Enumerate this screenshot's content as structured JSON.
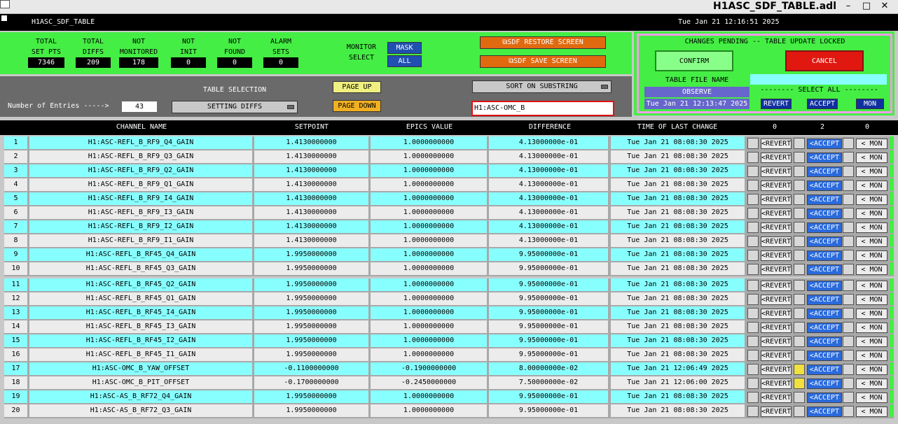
{
  "window": {
    "title": "H1ASC_SDF_TABLE.adl",
    "minimize": "–",
    "maximize": "□",
    "close": "✕"
  },
  "topbar": {
    "name": "H1ASC_SDF_TABLE",
    "datetime": "Tue Jan 21 12:16:51 2025"
  },
  "stats": [
    {
      "l1": "TOTAL",
      "l2": "SET PTS",
      "value": "7346"
    },
    {
      "l1": "TOTAL",
      "l2": "DIFFS",
      "value": "209"
    },
    {
      "l1": "NOT",
      "l2": "MONITORED",
      "value": "178"
    },
    {
      "l1": "NOT",
      "l2": "INIT",
      "value": "0"
    },
    {
      "l1": "NOT",
      "l2": "FOUND",
      "value": "0"
    },
    {
      "l1": "ALARM",
      "l2": "SETS",
      "value": "0"
    }
  ],
  "monitor": {
    "l1": "MONITOR",
    "l2": "SELECT",
    "mask": "MASK",
    "all": "ALL"
  },
  "screens": {
    "restore": "SDF RESTORE SCREEN",
    "save": "SDF SAVE SCREEN"
  },
  "changes": {
    "title": "CHANGES PENDING -- TABLE UPDATE LOCKED",
    "confirm": "CONFIRM",
    "cancel": "CANCEL",
    "file_label": "TABLE FILE NAME",
    "file_name": "OBSERVE",
    "file_date": "Tue Jan 21 12:13:47 2025",
    "select_all": "-------- SELECT ALL --------",
    "revert": "REVERT",
    "accept": "ACCEPT",
    "mon": "MON"
  },
  "controls": {
    "entries_label": "Number of Entries ----->",
    "entries": "43",
    "table_sel_label": "TABLE SELECTION",
    "table_sel": "SETTING DIFFS",
    "page_up": "PAGE UP",
    "page_down": "PAGE DOWN",
    "sort": "SORT ON SUBSTRING",
    "substring": "H1:ASC-OMC_B"
  },
  "header": {
    "channel": "CHANNEL NAME",
    "setpoint": "SETPOINT",
    "epics": "EPICS VALUE",
    "diff": "DIFFERENCE",
    "time": "TIME OF LAST CHANGE",
    "count_revert": "0",
    "count_accept": "2",
    "count_mon": "0"
  },
  "row_buttons": {
    "revert": "<REVERT",
    "accept": "<ACCEPT",
    "mon": "< MON"
  },
  "rows": [
    {
      "n": "1",
      "name": "H1:ASC-REFL_B_RF9_Q4_GAIN",
      "sp": "1.4130000000",
      "ev": "1.0000000000",
      "diff": "4.13000000e-01",
      "time": "Tue Jan 21 08:08:30 2025",
      "flag": false
    },
    {
      "n": "2",
      "name": "H1:ASC-REFL_B_RF9_Q3_GAIN",
      "sp": "1.4130000000",
      "ev": "1.0000000000",
      "diff": "4.13000000e-01",
      "time": "Tue Jan 21 08:08:30 2025",
      "flag": false
    },
    {
      "n": "3",
      "name": "H1:ASC-REFL_B_RF9_Q2_GAIN",
      "sp": "1.4130000000",
      "ev": "1.0000000000",
      "diff": "4.13000000e-01",
      "time": "Tue Jan 21 08:08:30 2025",
      "flag": false
    },
    {
      "n": "4",
      "name": "H1:ASC-REFL_B_RF9_Q1_GAIN",
      "sp": "1.4130000000",
      "ev": "1.0000000000",
      "diff": "4.13000000e-01",
      "time": "Tue Jan 21 08:08:30 2025",
      "flag": false
    },
    {
      "n": "5",
      "name": "H1:ASC-REFL_B_RF9_I4_GAIN",
      "sp": "1.4130000000",
      "ev": "1.0000000000",
      "diff": "4.13000000e-01",
      "time": "Tue Jan 21 08:08:30 2025",
      "flag": false
    },
    {
      "n": "6",
      "name": "H1:ASC-REFL_B_RF9_I3_GAIN",
      "sp": "1.4130000000",
      "ev": "1.0000000000",
      "diff": "4.13000000e-01",
      "time": "Tue Jan 21 08:08:30 2025",
      "flag": false
    },
    {
      "n": "7",
      "name": "H1:ASC-REFL_B_RF9_I2_GAIN",
      "sp": "1.4130000000",
      "ev": "1.0000000000",
      "diff": "4.13000000e-01",
      "time": "Tue Jan 21 08:08:30 2025",
      "flag": false
    },
    {
      "n": "8",
      "name": "H1:ASC-REFL_B_RF9_I1_GAIN",
      "sp": "1.4130000000",
      "ev": "1.0000000000",
      "diff": "4.13000000e-01",
      "time": "Tue Jan 21 08:08:30 2025",
      "flag": false
    },
    {
      "n": "9",
      "name": "H1:ASC-REFL_B_RF45_Q4_GAIN",
      "sp": "1.9950000000",
      "ev": "1.0000000000",
      "diff": "9.95000000e-01",
      "time": "Tue Jan 21 08:08:30 2025",
      "flag": false
    },
    {
      "n": "10",
      "name": "H1:ASC-REFL_B_RF45_Q3_GAIN",
      "sp": "1.9950000000",
      "ev": "1.0000000000",
      "diff": "9.95000000e-01",
      "time": "Tue Jan 21 08:08:30 2025",
      "flag": false
    },
    {
      "n": "11",
      "name": "H1:ASC-REFL_B_RF45_Q2_GAIN",
      "sp": "1.9950000000",
      "ev": "1.0000000000",
      "diff": "9.95000000e-01",
      "time": "Tue Jan 21 08:08:30 2025",
      "flag": false
    },
    {
      "n": "12",
      "name": "H1:ASC-REFL_B_RF45_Q1_GAIN",
      "sp": "1.9950000000",
      "ev": "1.0000000000",
      "diff": "9.95000000e-01",
      "time": "Tue Jan 21 08:08:30 2025",
      "flag": false
    },
    {
      "n": "13",
      "name": "H1:ASC-REFL_B_RF45_I4_GAIN",
      "sp": "1.9950000000",
      "ev": "1.0000000000",
      "diff": "9.95000000e-01",
      "time": "Tue Jan 21 08:08:30 2025",
      "flag": false
    },
    {
      "n": "14",
      "name": "H1:ASC-REFL_B_RF45_I3_GAIN",
      "sp": "1.9950000000",
      "ev": "1.0000000000",
      "diff": "9.95000000e-01",
      "time": "Tue Jan 21 08:08:30 2025",
      "flag": false
    },
    {
      "n": "15",
      "name": "H1:ASC-REFL_B_RF45_I2_GAIN",
      "sp": "1.9950000000",
      "ev": "1.0000000000",
      "diff": "9.95000000e-01",
      "time": "Tue Jan 21 08:08:30 2025",
      "flag": false
    },
    {
      "n": "16",
      "name": "H1:ASC-REFL_B_RF45_I1_GAIN",
      "sp": "1.9950000000",
      "ev": "1.0000000000",
      "diff": "9.95000000e-01",
      "time": "Tue Jan 21 08:08:30 2025",
      "flag": false
    },
    {
      "n": "17",
      "name": "H1:ASC-OMC_B_YAW_OFFSET",
      "sp": "-0.1100000000",
      "ev": "-0.1900000000",
      "diff": "8.00000000e-02",
      "time": "Tue Jan 21 12:06:49 2025",
      "flag": true
    },
    {
      "n": "18",
      "name": "H1:ASC-OMC_B_PIT_OFFSET",
      "sp": "-0.1700000000",
      "ev": "-0.2450000000",
      "diff": "7.50000000e-02",
      "time": "Tue Jan 21 12:06:00 2025",
      "flag": true
    },
    {
      "n": "19",
      "name": "H1:ASC-AS_B_RF72_Q4_GAIN",
      "sp": "1.9950000000",
      "ev": "1.0000000000",
      "diff": "9.95000000e-01",
      "time": "Tue Jan 21 08:08:30 2025",
      "flag": false
    },
    {
      "n": "20",
      "name": "H1:ASC-AS_B_RF72_Q3_GAIN",
      "sp": "1.9950000000",
      "ev": "1.0000000000",
      "diff": "9.95000000e-01",
      "time": "Tue Jan 21 08:08:30 2025",
      "flag": false
    }
  ],
  "colors": {
    "cyan": "#88ffff",
    "light": "#ececec",
    "flag": "#f0e040",
    "accept_bg": "#2050b0"
  }
}
